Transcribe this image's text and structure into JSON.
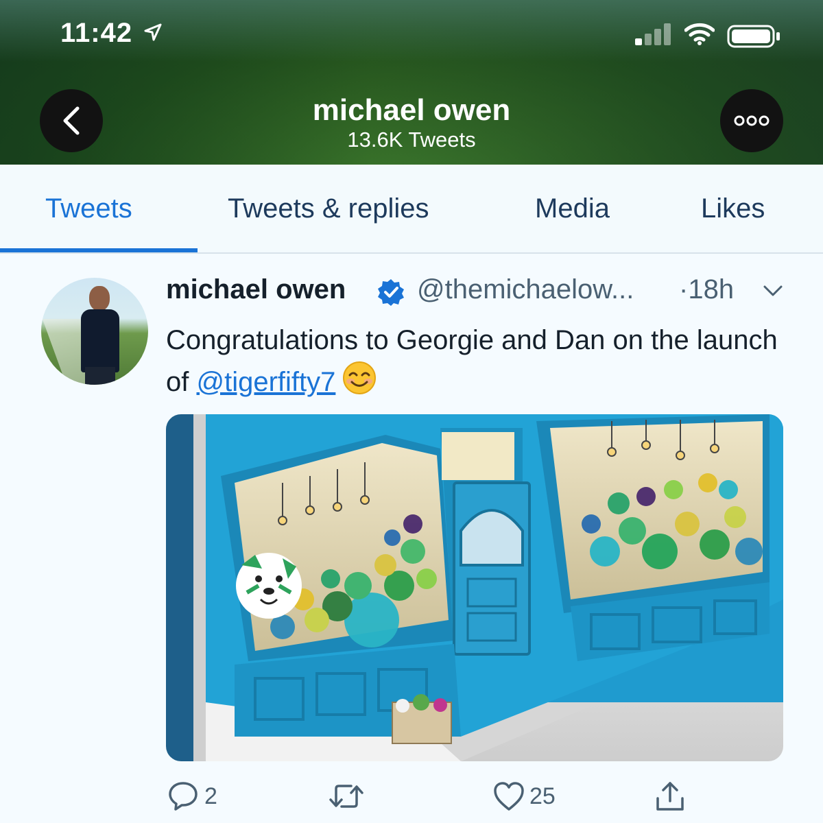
{
  "status_bar": {
    "time": "11:42",
    "icons": [
      "location-arrow-icon",
      "signal-bars-icon",
      "wifi-icon",
      "battery-icon"
    ]
  },
  "header": {
    "name": "michael owen",
    "tweet_count": "13.6K Tweets",
    "back_icon": "chevron-left-icon",
    "more_icon": "more-dots-icon"
  },
  "tabs": [
    {
      "label": "Tweets",
      "active": true
    },
    {
      "label": "Tweets & replies",
      "active": false
    },
    {
      "label": "Media",
      "active": false
    },
    {
      "label": "Likes",
      "active": false
    }
  ],
  "tweet": {
    "author_name": "michael owen",
    "handle": "@themichaelow...",
    "time": "·18h",
    "text_before": "Congratulations to Georgie and Dan on the launch of ",
    "mention": "@tigerfifty7",
    "emoji": "smiling-face-emoji",
    "actions": {
      "reply_count": "2",
      "retweet_count": "",
      "like_count": "25"
    }
  },
  "colors": {
    "accent": "#1a73d6",
    "tab_text": "#1d3a5c",
    "shop_blue": "#2aa8d6"
  }
}
